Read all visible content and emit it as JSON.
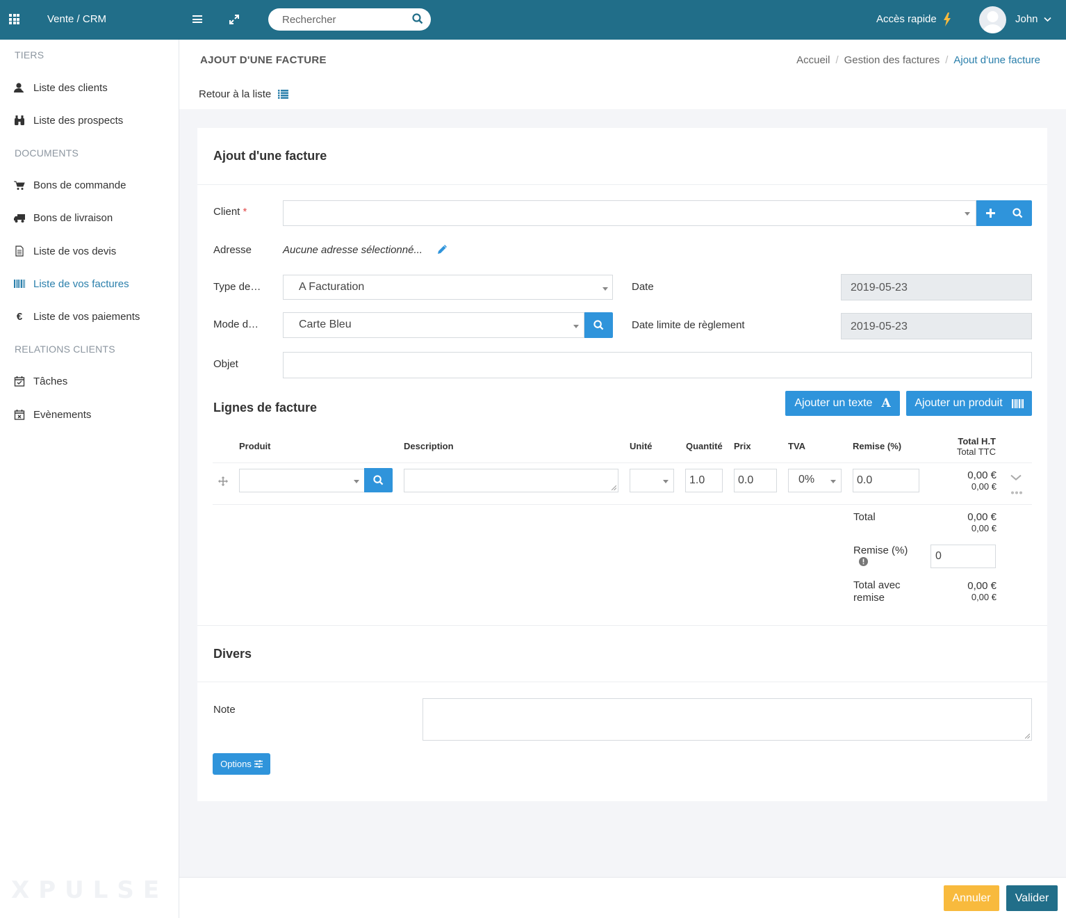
{
  "topbar": {
    "app_title": "Vente / CRM",
    "search_placeholder": "Rechercher",
    "quick_access": "Accès rapide",
    "user_name": "John"
  },
  "sidebar": {
    "sections": [
      {
        "title": "TIERS",
        "items": [
          {
            "label": "Liste des clients",
            "icon": "user-icon"
          },
          {
            "label": "Liste des prospects",
            "icon": "binoculars-icon"
          }
        ]
      },
      {
        "title": "DOCUMENTS",
        "items": [
          {
            "label": "Bons de commande",
            "icon": "cart-icon"
          },
          {
            "label": "Bons de livraison",
            "icon": "truck-icon"
          },
          {
            "label": "Liste de vos devis",
            "icon": "document-icon"
          },
          {
            "label": "Liste de vos factures",
            "icon": "barcode-icon",
            "active": true
          },
          {
            "label": "Liste de vos paiements",
            "icon": "euro-icon"
          }
        ]
      },
      {
        "title": "RELATIONS CLIENTS",
        "items": [
          {
            "label": "Tâches",
            "icon": "calendar-check-icon"
          },
          {
            "label": "Evènements",
            "icon": "calendar-x-icon"
          }
        ]
      }
    ],
    "brand": "XPULSE"
  },
  "header": {
    "title": "AJOUT D'UNE FACTURE",
    "breadcrumb": [
      "Accueil",
      "Gestion des factures",
      "Ajout d'une facture"
    ],
    "back_label": "Retour à la liste"
  },
  "form": {
    "title": "Ajout d'une facture",
    "client_label": "Client",
    "required_mark": "*",
    "client_value": "",
    "address_label": "Adresse",
    "address_value": "Aucune adresse sélectionné...",
    "type_label": "Type de…",
    "type_value": "A Facturation",
    "date_label": "Date",
    "date_value": "2019-05-23",
    "mode_label": "Mode d…",
    "mode_value": "Carte Bleu",
    "due_label": "Date limite de règlement",
    "due_value": "2019-05-23",
    "object_label": "Objet",
    "object_value": ""
  },
  "lines": {
    "title": "Lignes de facture",
    "add_text_label": "Ajouter un texte",
    "add_product_label": "Ajouter un produit",
    "columns": {
      "product": "Produit",
      "description": "Description",
      "unit": "Unité",
      "quantity": "Quantité",
      "price": "Prix",
      "tva": "TVA",
      "discount": "Remise (%)",
      "total_ht": "Total H.T",
      "total_ttc": "Total TTC"
    },
    "row": {
      "quantity": "1.0",
      "price": "0.0",
      "tva": "0%",
      "discount": "0.0",
      "total_ht": "0,00 €",
      "total_ttc": "0,00 €"
    },
    "summary": {
      "total_label": "Total",
      "total_ht": "0,00 €",
      "total_ttc": "0,00 €",
      "discount_label": "Remise (%)",
      "discount_value": "0",
      "total_discount_label_1": "Total avec",
      "total_discount_label_2": "remise",
      "total_discount_ht": "0,00 €",
      "total_discount_ttc": "0,00 €"
    }
  },
  "misc": {
    "title": "Divers",
    "note_label": "Note",
    "note_value": "",
    "options_label": "Options"
  },
  "footer": {
    "cancel_label": "Annuler",
    "validate_label": "Valider"
  },
  "colors": {
    "topbar": "#216e89",
    "primary_button": "#2f94db",
    "cancel_button": "#f8ba3d",
    "validate_button": "#216e89",
    "active_link": "#2a7fab"
  }
}
